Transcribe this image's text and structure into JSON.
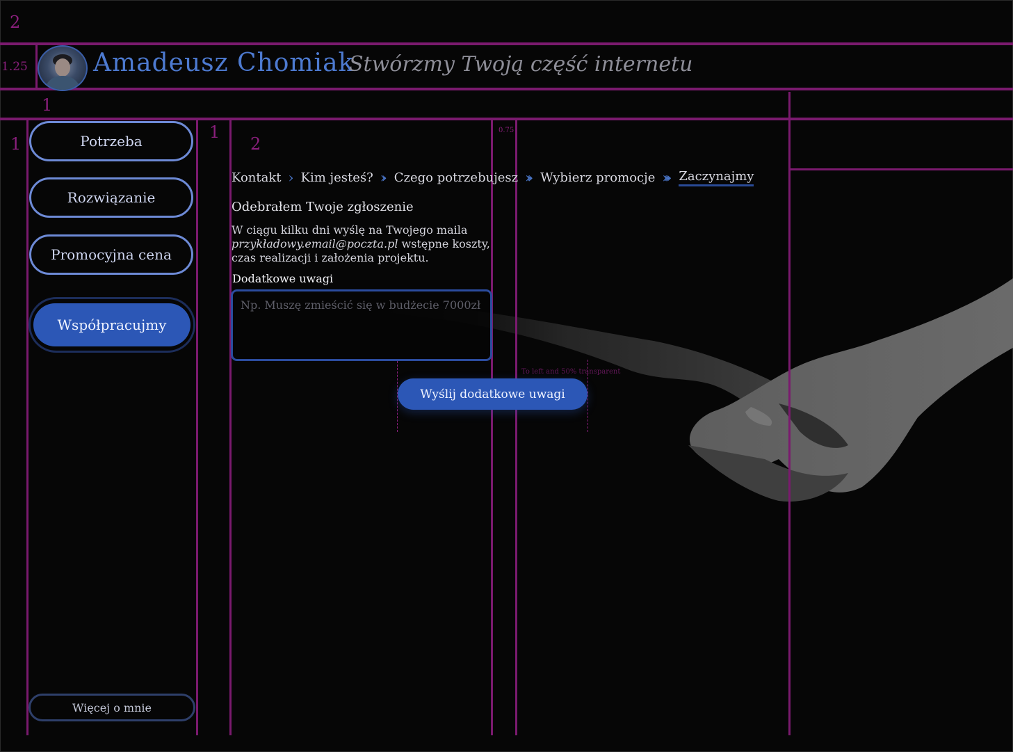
{
  "header": {
    "name": "Amadeusz Chomiak",
    "tagline": "Stwórzmy Twoją część internetu"
  },
  "sidebar": {
    "items": [
      {
        "label": "Potrzeba"
      },
      {
        "label": "Rozwiązanie"
      },
      {
        "label": "Promocyjna cena"
      }
    ],
    "cta_label": "Współpracujmy",
    "more_label": "Więcej o mnie"
  },
  "breadcrumb": {
    "items": [
      "Kontakt",
      "Kim jesteś?",
      "Czego potrzebujesz",
      "Wybierz promocje",
      "Zaczynajmy"
    ],
    "active": "Zaczynajmy"
  },
  "main": {
    "heading": "Odebrałem Twoje zgłoszenie",
    "message_before": "W ciągu kilku dni wyślę na Twojego maila",
    "email": "przykładowy.email@poczta.pl",
    "message_after": "wstępne koszty, czas realizacji i założenia projektu.",
    "notes_label": "Dodatkowe uwagi",
    "notes_placeholder": "Np. Muszę zmieścić się w budżecie 7000zł",
    "notes_value": "",
    "send_label": "Wyślij dodatkowe uwagi"
  },
  "guides": {
    "top_band": "2",
    "header_band": "1.25",
    "gap_band": "1",
    "sidebar_margin": "1",
    "sidebar_gap": "1",
    "content_margin": "2",
    "column_gap": "0.75",
    "image_note": "To left and 50% transparent"
  },
  "colors": {
    "background": "#060606",
    "accent": "#2c57b6",
    "name": "#4d7ad0",
    "guide": "#7a1a6e"
  }
}
